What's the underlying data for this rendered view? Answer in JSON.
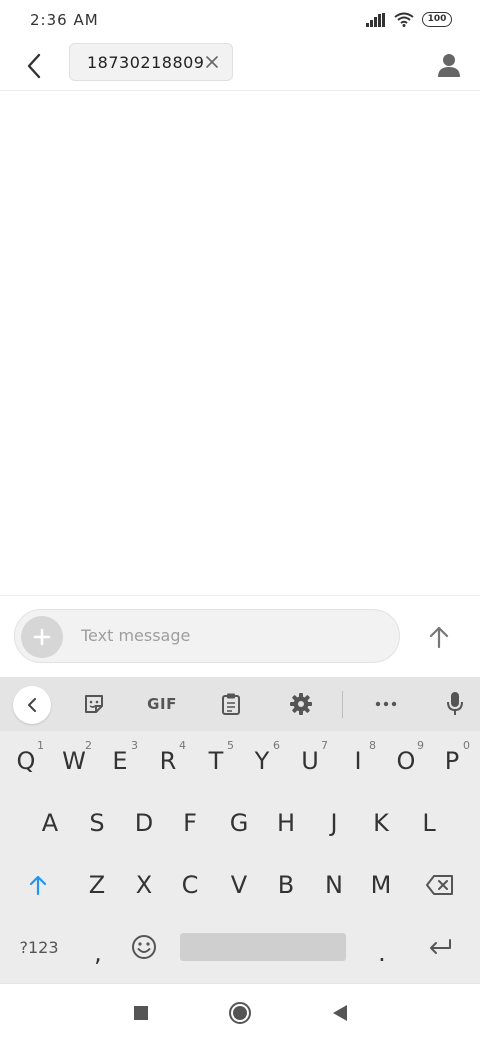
{
  "status_bar": {
    "time": "2:36 AM",
    "battery": "100"
  },
  "header": {
    "recipient": "18730218809"
  },
  "compose": {
    "placeholder": "Text message"
  },
  "keyboard": {
    "toolbar": {
      "gif_label": "GIF"
    },
    "row1": [
      {
        "key": "Q",
        "hint": "1"
      },
      {
        "key": "W",
        "hint": "2"
      },
      {
        "key": "E",
        "hint": "3"
      },
      {
        "key": "R",
        "hint": "4"
      },
      {
        "key": "T",
        "hint": "5"
      },
      {
        "key": "Y",
        "hint": "6"
      },
      {
        "key": "U",
        "hint": "7"
      },
      {
        "key": "I",
        "hint": "8"
      },
      {
        "key": "O",
        "hint": "9"
      },
      {
        "key": "P",
        "hint": "0"
      }
    ],
    "row2": [
      "A",
      "S",
      "D",
      "F",
      "G",
      "H",
      "J",
      "K",
      "L"
    ],
    "row3": [
      "Z",
      "X",
      "C",
      "V",
      "B",
      "N",
      "M"
    ],
    "symbols_label": "?123",
    "comma": ",",
    "period": "."
  },
  "colors": {
    "accent": "#2196f3",
    "keyboard_bg": "#ececec",
    "toolbar_bg": "#e4e4e4"
  },
  "icons": [
    "back-arrow-icon",
    "close-icon",
    "contact-icon",
    "plus-icon",
    "send-arrow-icon",
    "chevron-left-icon",
    "sticker-icon",
    "clipboard-icon",
    "gear-icon",
    "more-icon",
    "mic-icon",
    "shift-icon",
    "backspace-icon",
    "emoji-icon",
    "enter-icon",
    "recents-icon",
    "home-icon",
    "back-triangle-icon"
  ]
}
